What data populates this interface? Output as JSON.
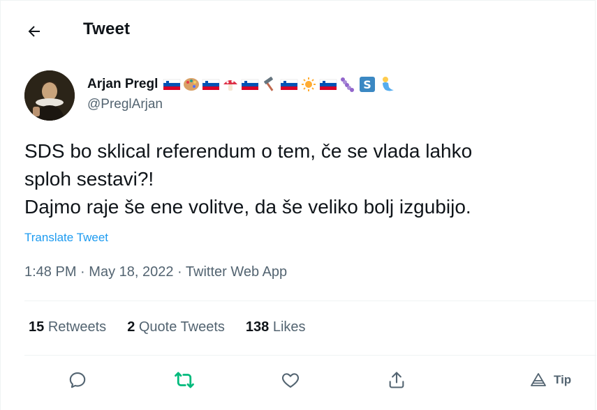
{
  "header": {
    "title": "Tweet"
  },
  "author": {
    "display_name": "Arjan Pregl",
    "name_emojis": [
      "slovenia-flag",
      "artist-palette",
      "slovenia-flag",
      "mushroom",
      "slovenia-flag",
      "hammer",
      "slovenia-flag",
      "sun",
      "slovenia-flag",
      "caterpillar",
      "s-block",
      "merperson"
    ],
    "handle": "@PreglArjan"
  },
  "tweet": {
    "lines": [
      "SDS bo sklical referendum o tem, če se vlada lahko",
      "sploh sestavi?!",
      "Dajmo raje še ene volitve, da še veliko bolj izgubijo."
    ],
    "translate_label": "Translate Tweet",
    "time": "1:48 PM",
    "date": "May 18, 2022",
    "source": "Twitter Web App",
    "separator": "·"
  },
  "stats": {
    "retweets": {
      "count": "15",
      "label": "Retweets"
    },
    "quotes": {
      "count": "2",
      "label": "Quote Tweets"
    },
    "likes": {
      "count": "138",
      "label": "Likes"
    }
  },
  "actions": {
    "tip_label": "Tip"
  },
  "colors": {
    "accent": "#1d9bf0",
    "retweet_green": "#00ba7c",
    "muted": "#536471",
    "divider": "#eff3f4"
  }
}
